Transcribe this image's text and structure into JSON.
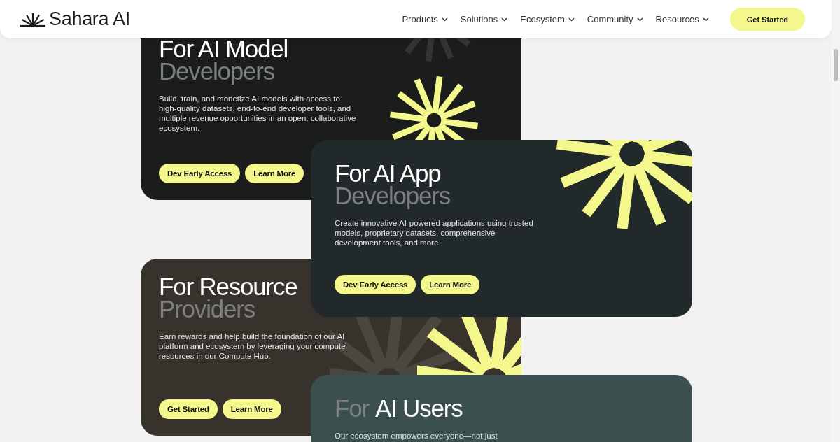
{
  "header": {
    "logo": "Sahara AI",
    "nav": [
      {
        "label": "Products"
      },
      {
        "label": "Solutions"
      },
      {
        "label": "Ecosystem"
      },
      {
        "label": "Community"
      },
      {
        "label": "Resources"
      }
    ],
    "cta": "Get Started"
  },
  "cards": [
    {
      "color": "#1b1c1c",
      "title_lines": [
        [
          {
            "text": "For AI Model",
            "muted": false
          }
        ],
        [
          {
            "text": "Developers",
            "muted": true
          }
        ]
      ],
      "body": "Build, train, and monetize AI models with access to high-quality datasets, end-to-end developer tools, and multiple revenue opportunities in an open, collaborative ecosystem.",
      "buttons": [
        "Dev Early Access",
        "Learn More"
      ]
    },
    {
      "color": "#22292a",
      "title_lines": [
        [
          {
            "text": "For AI App",
            "muted": false
          }
        ],
        [
          {
            "text": "Developers",
            "muted": true
          }
        ]
      ],
      "body": "Create innovative AI-powered applications using trusted models, proprietary datasets, comprehensive development tools, and more.",
      "buttons": [
        "Dev Early Access",
        "Learn More"
      ]
    },
    {
      "color": "#37332c",
      "title_lines": [
        [
          {
            "text": "For Resource",
            "muted": false
          }
        ],
        [
          {
            "text": "Providers",
            "muted": true
          }
        ]
      ],
      "body": "Earn rewards and help build the foundation of our AI platform and ecosystem by leveraging your compute resources in our Compute Hub.",
      "buttons": [
        "Get Started",
        "Learn More"
      ]
    },
    {
      "color": "#3b4f4f",
      "title_lines": [
        [
          {
            "text": "For",
            "muted": true
          },
          {
            "text": "AI Users",
            "muted": false
          }
        ]
      ],
      "body": "Our ecosystem empowers everyone—not just"
    }
  ]
}
